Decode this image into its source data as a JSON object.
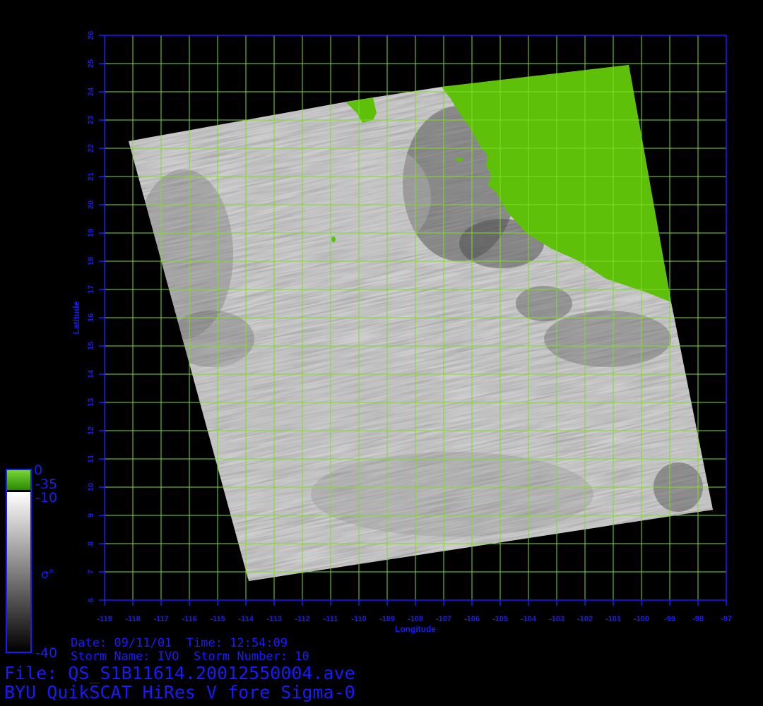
{
  "map": {
    "x_axis_title": "Longitude",
    "y_axis_title": "Latitude",
    "lon_ticks": [
      "-119",
      "-118",
      "-117",
      "-116",
      "-115",
      "-114",
      "-113",
      "-112",
      "-111",
      "-110",
      "-109",
      "-108",
      "-107",
      "-106",
      "-105",
      "-104",
      "-103",
      "-102",
      "-101",
      "-100",
      "-99",
      "-98",
      "-97"
    ],
    "lat_ticks": [
      "6",
      "7",
      "8",
      "9",
      "10",
      "11",
      "12",
      "13",
      "14",
      "15",
      "16",
      "17",
      "18",
      "19",
      "20",
      "21",
      "22",
      "23",
      "24",
      "25",
      "26"
    ],
    "lon_range": [
      -119,
      -97
    ],
    "lat_range": [
      6,
      26
    ],
    "grid": true,
    "colors": {
      "axis": "#1a1aff",
      "grid": "#7cdc2a",
      "land": "#5fc00a",
      "background": "#000000"
    }
  },
  "colorbar": {
    "labels": {
      "top": "0",
      "land_low": "-35",
      "sea_high": "-10",
      "bottom": "-40"
    },
    "symbol": "σ°"
  },
  "info": {
    "line1": "Date: 09/11/01  Time: 12:54:09",
    "line2": "Storm Name: IVO  Storm Number: 10",
    "file": "File: QS_S1B11614.20012550004.ave",
    "product": "BYU QuikSCAT HiRes V fore Sigma-0"
  }
}
